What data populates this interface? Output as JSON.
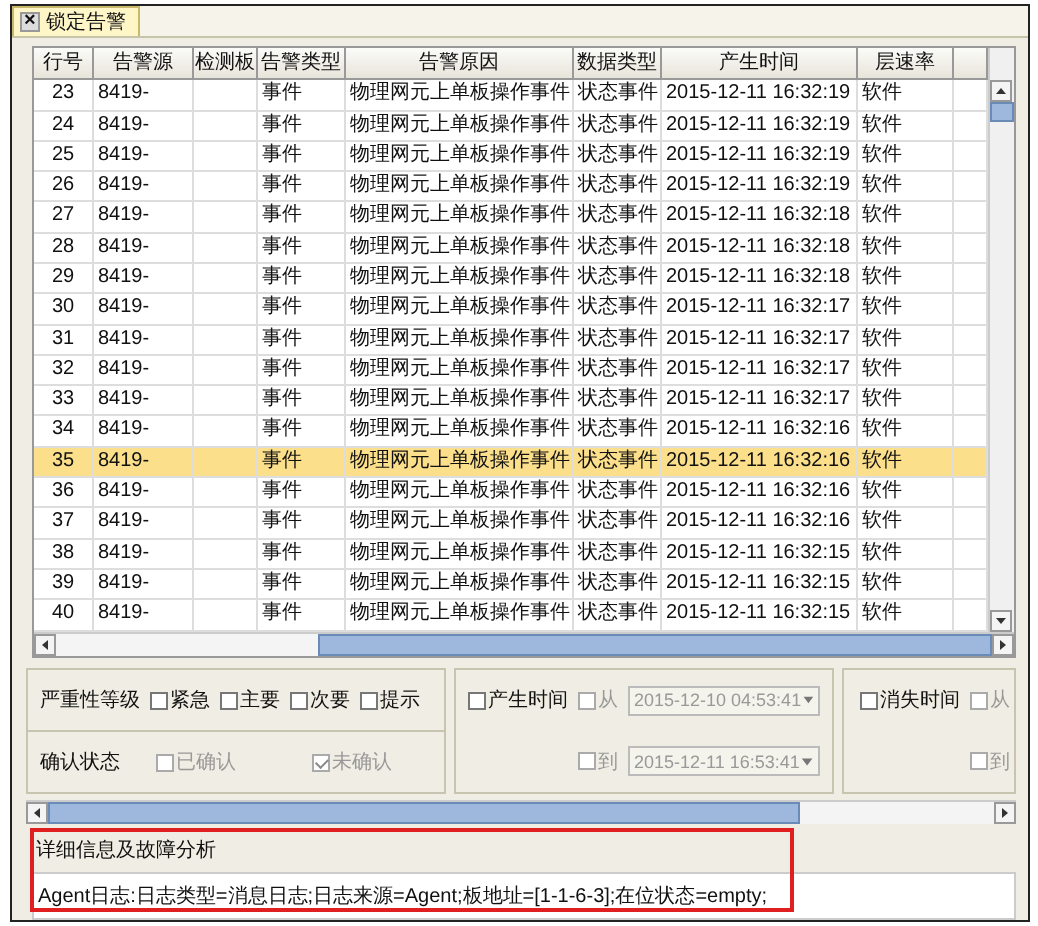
{
  "tabs": [
    {
      "label": "锁定告警",
      "close": "×",
      "selected": true
    }
  ],
  "table": {
    "columns": [
      "行号",
      "告警源",
      "检测板",
      "告警类型",
      "告警原因",
      "数据类型",
      "产生时间",
      "层速率"
    ],
    "rows": [
      {
        "cells": [
          "23",
          "8419-",
          "",
          "事件",
          "物理网元上单板操作事件",
          "状态事件",
          "2015-12-11 16:32:19",
          "软件"
        ],
        "selected": false
      },
      {
        "cells": [
          "24",
          "8419-",
          "",
          "事件",
          "物理网元上单板操作事件",
          "状态事件",
          "2015-12-11 16:32:19",
          "软件"
        ],
        "selected": false
      },
      {
        "cells": [
          "25",
          "8419-",
          "",
          "事件",
          "物理网元上单板操作事件",
          "状态事件",
          "2015-12-11 16:32:19",
          "软件"
        ],
        "selected": false
      },
      {
        "cells": [
          "26",
          "8419-",
          "",
          "事件",
          "物理网元上单板操作事件",
          "状态事件",
          "2015-12-11 16:32:19",
          "软件"
        ],
        "selected": false
      },
      {
        "cells": [
          "27",
          "8419-",
          "",
          "事件",
          "物理网元上单板操作事件",
          "状态事件",
          "2015-12-11 16:32:18",
          "软件"
        ],
        "selected": false
      },
      {
        "cells": [
          "28",
          "8419-",
          "",
          "事件",
          "物理网元上单板操作事件",
          "状态事件",
          "2015-12-11 16:32:18",
          "软件"
        ],
        "selected": false
      },
      {
        "cells": [
          "29",
          "8419-",
          "",
          "事件",
          "物理网元上单板操作事件",
          "状态事件",
          "2015-12-11 16:32:18",
          "软件"
        ],
        "selected": false
      },
      {
        "cells": [
          "30",
          "8419-",
          "",
          "事件",
          "物理网元上单板操作事件",
          "状态事件",
          "2015-12-11 16:32:17",
          "软件"
        ],
        "selected": false
      },
      {
        "cells": [
          "31",
          "8419-",
          "",
          "事件",
          "物理网元上单板操作事件",
          "状态事件",
          "2015-12-11 16:32:17",
          "软件"
        ],
        "selected": false
      },
      {
        "cells": [
          "32",
          "8419-",
          "",
          "事件",
          "物理网元上单板操作事件",
          "状态事件",
          "2015-12-11 16:32:17",
          "软件"
        ],
        "selected": false
      },
      {
        "cells": [
          "33",
          "8419-",
          "",
          "事件",
          "物理网元上单板操作事件",
          "状态事件",
          "2015-12-11 16:32:17",
          "软件"
        ],
        "selected": false
      },
      {
        "cells": [
          "34",
          "8419-",
          "",
          "事件",
          "物理网元上单板操作事件",
          "状态事件",
          "2015-12-11 16:32:16",
          "软件"
        ],
        "selected": false
      },
      {
        "cells": [
          "35",
          "8419-",
          "",
          "事件",
          "物理网元上单板操作事件",
          "状态事件",
          "2015-12-11 16:32:16",
          "软件"
        ],
        "selected": true
      },
      {
        "cells": [
          "36",
          "8419-",
          "",
          "事件",
          "物理网元上单板操作事件",
          "状态事件",
          "2015-12-11 16:32:16",
          "软件"
        ],
        "selected": false
      },
      {
        "cells": [
          "37",
          "8419-",
          "",
          "事件",
          "物理网元上单板操作事件",
          "状态事件",
          "2015-12-11 16:32:16",
          "软件"
        ],
        "selected": false
      },
      {
        "cells": [
          "38",
          "8419-",
          "",
          "事件",
          "物理网元上单板操作事件",
          "状态事件",
          "2015-12-11 16:32:15",
          "软件"
        ],
        "selected": false
      },
      {
        "cells": [
          "39",
          "8419-",
          "",
          "事件",
          "物理网元上单板操作事件",
          "状态事件",
          "2015-12-11 16:32:15",
          "软件"
        ],
        "selected": false
      },
      {
        "cells": [
          "40",
          "8419-",
          "",
          "事件",
          "物理网元上单板操作事件",
          "状态事件",
          "2015-12-11 16:32:15",
          "软件"
        ],
        "selected": false
      }
    ]
  },
  "severity": {
    "label": "严重性等级",
    "options": [
      {
        "label": "紧急",
        "checked": false,
        "disabled": false
      },
      {
        "label": "主要",
        "checked": false,
        "disabled": false
      },
      {
        "label": "次要",
        "checked": false,
        "disabled": false
      },
      {
        "label": "提示",
        "checked": false,
        "disabled": false
      }
    ]
  },
  "ack": {
    "label": "确认状态",
    "options": [
      {
        "label": "已确认",
        "checked": false,
        "disabled": true
      },
      {
        "label": "未确认",
        "checked": true,
        "disabled": true
      }
    ]
  },
  "raise_time": {
    "label": "产生时间",
    "checked": false,
    "from": {
      "label": "从",
      "checked": false,
      "disabled": true,
      "value": "2015-12-10 04:53:41"
    },
    "to": {
      "label": "到",
      "checked": false,
      "disabled": true,
      "value": "2015-12-11 16:53:41"
    }
  },
  "clear_time": {
    "label": "消失时间",
    "checked": false,
    "from": {
      "label": "从",
      "checked": false,
      "disabled": true
    },
    "to": {
      "label": "到",
      "checked": false,
      "disabled": true
    }
  },
  "details": {
    "title": "详细信息及故障分析",
    "text": "Agent日志:日志类型=消息日志;日志来源=Agent;板地址=[1-1-6-3];在位状态=empty;"
  }
}
